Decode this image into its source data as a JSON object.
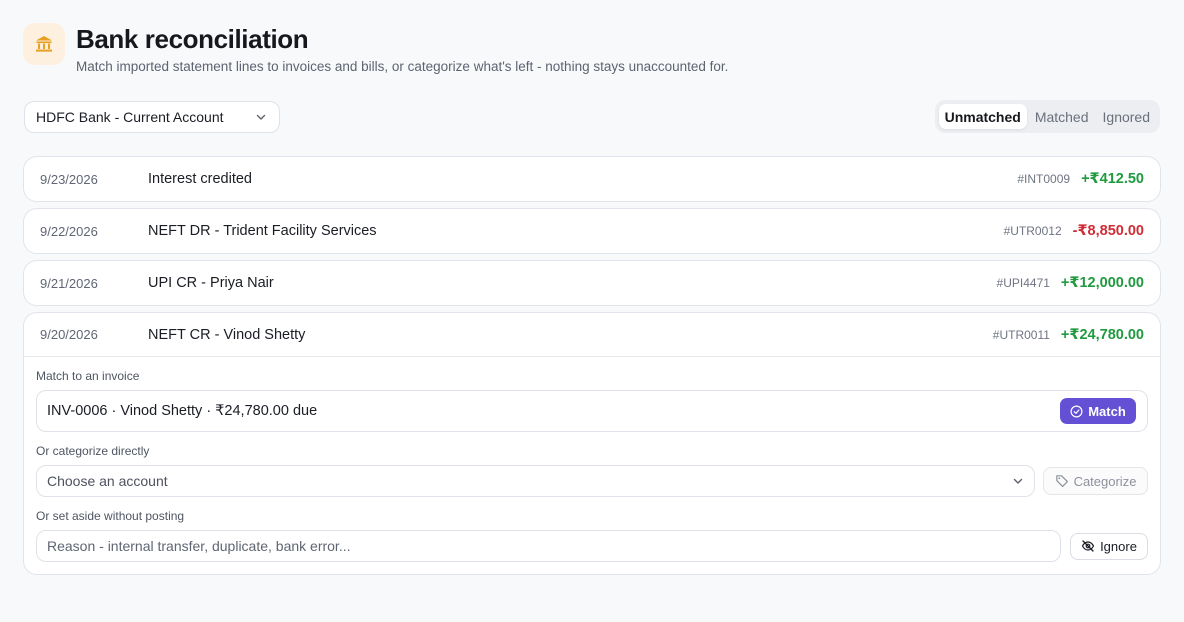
{
  "header": {
    "icon": "bank-icon",
    "title": "Bank reconciliation",
    "subtitle": "Match imported statement lines to invoices and bills, or categorize what's left - nothing stays unaccounted for."
  },
  "toolbar": {
    "account": "HDFC Bank - Current Account",
    "tabs": [
      {
        "label": "Unmatched",
        "active": true
      },
      {
        "label": "Matched",
        "active": false
      },
      {
        "label": "Ignored",
        "active": false
      }
    ]
  },
  "transactions": [
    {
      "date": "9/23/2026",
      "description": "Interest credited",
      "ref": "#INT0009",
      "amount": "+₹412.50",
      "direction": "credit"
    },
    {
      "date": "9/22/2026",
      "description": "NEFT DR - Trident Facility Services",
      "ref": "#UTR0012",
      "amount": "-₹8,850.00",
      "direction": "debit"
    },
    {
      "date": "9/21/2026",
      "description": "UPI CR - Priya Nair",
      "ref": "#UPI4471",
      "amount": "+₹12,000.00",
      "direction": "credit"
    },
    {
      "date": "9/20/2026",
      "description": "NEFT CR - Vinod Shetty",
      "ref": "#UTR0011",
      "amount": "+₹24,780.00",
      "direction": "credit"
    }
  ],
  "expanded": {
    "match_label": "Match to an invoice",
    "invoice": "INV-0006 · Vinod Shetty · ₹24,780.00 due",
    "match_button": "Match",
    "categorize_label": "Or categorize directly",
    "account_placeholder": "Choose an account",
    "categorize_button": "Categorize",
    "ignore_label": "Or set aside without posting",
    "reason_placeholder": "Reason - internal transfer, duplicate, bank error...",
    "ignore_button": "Ignore"
  },
  "colors": {
    "accent": "#6350d4",
    "credit": "#1f9a3f",
    "debit": "#d02c36",
    "badge_bg": "#fdf0df",
    "badge_icon": "#e8a020"
  }
}
